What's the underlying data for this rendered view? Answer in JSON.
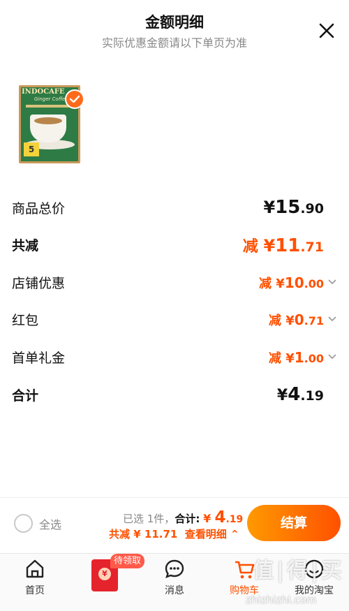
{
  "header": {
    "title": "金额明细",
    "subtitle": "实际优惠金额请以下单页为准"
  },
  "product": {
    "brand": "INDOCAFE",
    "variant": "Ginger Coffeemix",
    "pack_count": "5"
  },
  "rows": [
    {
      "label": "商品总价",
      "currency": "¥",
      "integer": "15",
      "decimal": ".90",
      "prefix": ""
    },
    {
      "label": "共减",
      "currency": "¥",
      "integer": "11",
      "decimal": ".71",
      "prefix": "减 "
    },
    {
      "label": "店铺优惠",
      "currency": "¥",
      "integer": "10",
      "decimal": ".00",
      "prefix": "减 "
    },
    {
      "label": "红包",
      "currency": "¥",
      "integer": "0",
      "decimal": ".71",
      "prefix": "减 "
    },
    {
      "label": "首单礼金",
      "currency": "¥",
      "integer": "1",
      "decimal": ".00",
      "prefix": "减 "
    },
    {
      "label": "合计",
      "currency": "¥",
      "integer": "4",
      "decimal": ".19",
      "prefix": ""
    }
  ],
  "footer": {
    "select_all": "全选",
    "selected_text": "已选 1件，",
    "total_label": "合计:",
    "total_currency": "¥",
    "total_integer": "4",
    "total_decimal": ".19",
    "reduce_text": "共减 ¥ 11.71",
    "detail_link": "查看明细",
    "checkout": "结算"
  },
  "tabbar": {
    "items": [
      {
        "label": "首页",
        "icon": "home-icon"
      },
      {
        "label": "",
        "icon": "red-packet-icon",
        "badge": "待领取"
      },
      {
        "label": "消息",
        "icon": "message-icon"
      },
      {
        "label": "购物车",
        "icon": "cart-icon"
      },
      {
        "label": "我的淘宝",
        "icon": "profile-icon"
      }
    ]
  },
  "watermark": {
    "logo": "值|得|买",
    "url": "zhizhizhi.com"
  },
  "colors": {
    "accent": "#ff5000",
    "checkout_gradient_start": "#ff9a00",
    "checkout_gradient_end": "#ff5000"
  }
}
